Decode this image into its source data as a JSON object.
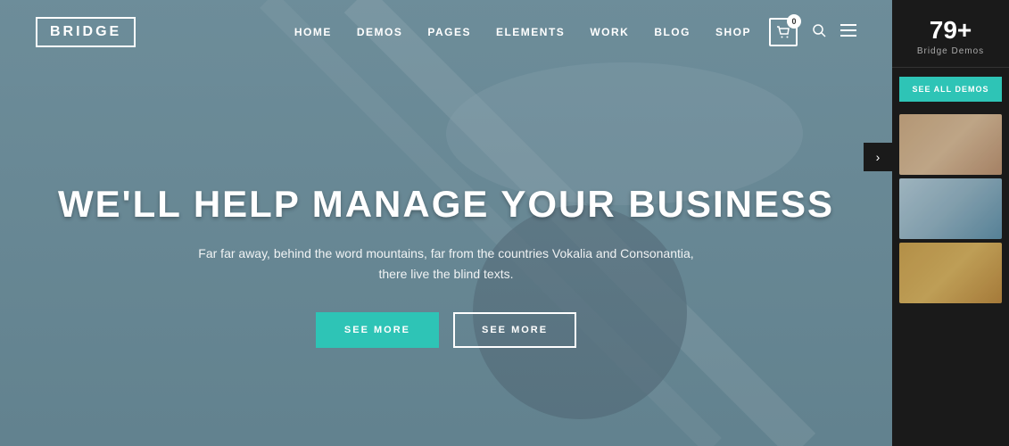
{
  "logo": {
    "text": "BRIDGE"
  },
  "navbar": {
    "links": [
      {
        "label": "HOME",
        "id": "home"
      },
      {
        "label": "DEMOS",
        "id": "demos"
      },
      {
        "label": "PAGES",
        "id": "pages"
      },
      {
        "label": "ELEMENTS",
        "id": "elements"
      },
      {
        "label": "WORK",
        "id": "work"
      },
      {
        "label": "BLOG",
        "id": "blog"
      },
      {
        "label": "SHOP",
        "id": "shop"
      }
    ],
    "cart_count": "0"
  },
  "hero": {
    "title": "WE'LL HELP MANAGE YOUR BUSINESS",
    "subtitle": "Far far away, behind the word mountains, far from the countries Vokalia and Consonantia, there live the blind texts.",
    "btn_primary": "SEE MORE",
    "btn_outline": "SEE MORE"
  },
  "sidebar": {
    "count": "79+",
    "label": "Bridge Demos",
    "see_all_label": "SEE ALL DEMOS",
    "toggle_icon": "›",
    "thumbnails": [
      {
        "id": "thumb-1"
      },
      {
        "id": "thumb-2"
      },
      {
        "id": "thumb-3"
      }
    ]
  },
  "icons": {
    "cart": "🛒",
    "search": "🔍",
    "menu": "☰",
    "chevron": "›"
  }
}
